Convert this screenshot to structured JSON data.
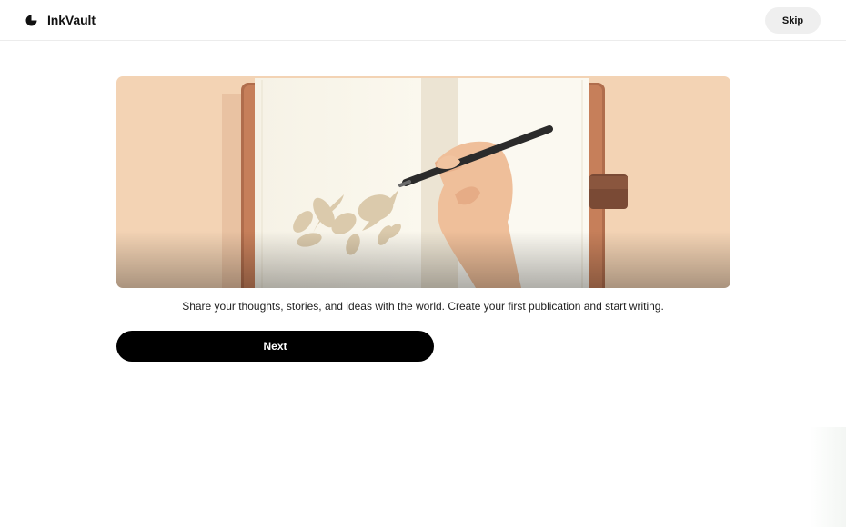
{
  "header": {
    "app_name": "InkVault",
    "logo_icon": "ink-drop-icon",
    "skip_label": "Skip"
  },
  "onboarding": {
    "illustration": "notebook-writing-illustration",
    "description": "Share your thoughts, stories, and ideas with the world. Create your first publication and start writing.",
    "next_label": "Next"
  },
  "colors": {
    "primary_button": "#000000",
    "skip_button_bg": "#efefef",
    "illustration_bg": "#f3d3b4"
  }
}
